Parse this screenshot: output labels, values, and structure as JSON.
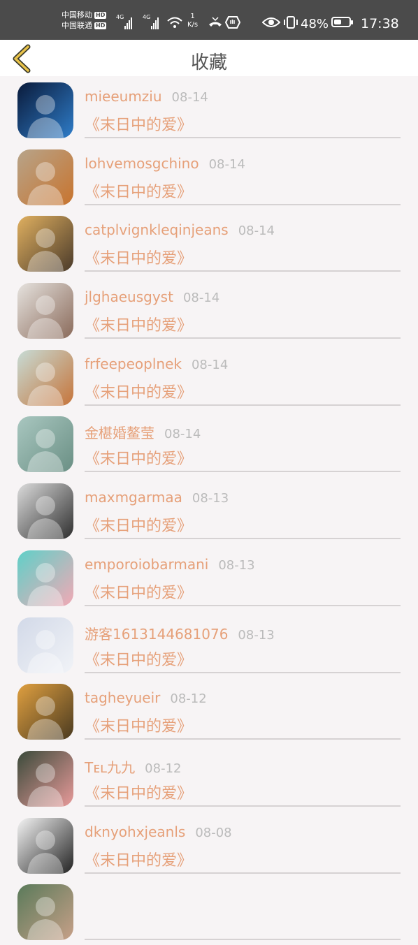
{
  "status_bar": {
    "carrier1": "中国移动",
    "carrier2": "中国联通",
    "hd": "HD",
    "network": "4G",
    "speed_value": "1",
    "speed_unit": "K/s",
    "battery": "48%",
    "battery_level": 0.48,
    "time": "17:38"
  },
  "header": {
    "title": "收藏"
  },
  "favorites": [
    {
      "user": "mieeumziu",
      "date": "08-14",
      "title": "《末日中的爱》",
      "colors": [
        "#0a1a3a",
        "#2f7dc9"
      ]
    },
    {
      "user": "lohvemosgchino",
      "date": "08-14",
      "title": "《末日中的爱》",
      "colors": [
        "#b7a48a",
        "#c8742e"
      ]
    },
    {
      "user": "catplvignkleqinjeans",
      "date": "08-14",
      "title": "《末日中的爱》",
      "colors": [
        "#e0b060",
        "#4a3a2a"
      ]
    },
    {
      "user": "jlghaeusgyst",
      "date": "08-14",
      "title": "《末日中的爱》",
      "colors": [
        "#e6e3df",
        "#8a6a5a"
      ]
    },
    {
      "user": "frfeepeoplnek",
      "date": "08-14",
      "title": "《末日中的爱》",
      "colors": [
        "#c7dcd6",
        "#c6743a"
      ]
    },
    {
      "user": "金椹婚鳌莹",
      "date": "08-14",
      "title": "《末日中的爱》",
      "colors": [
        "#a9c7c0",
        "#6a8f84"
      ]
    },
    {
      "user": "maxmgarmaa",
      "date": "08-13",
      "title": "《末日中的爱》",
      "colors": [
        "#dcdcdc",
        "#2e2e2e"
      ]
    },
    {
      "user": "emporoiobarmani",
      "date": "08-13",
      "title": "《末日中的爱》",
      "colors": [
        "#5fd0c8",
        "#f2a9b5"
      ]
    },
    {
      "user": "游客1613144681076",
      "date": "08-13",
      "title": "《末日中的爱》",
      "colors": [
        "#d2d9e8",
        "#f1f3f7"
      ]
    },
    {
      "user": "tagheyueir",
      "date": "08-12",
      "title": "《末日中的爱》",
      "colors": [
        "#e0a040",
        "#4a3a20"
      ]
    },
    {
      "user": "Tᴇʟ九九",
      "date": "08-12",
      "title": "《末日中的爱》",
      "colors": [
        "#3a4a3a",
        "#e89a9a"
      ]
    },
    {
      "user": "dknyohxjeanls",
      "date": "08-08",
      "title": "《末日中的爱》",
      "colors": [
        "#f5f5f5",
        "#222222"
      ]
    },
    {
      "user": "",
      "date": "",
      "title": "",
      "colors": [
        "#5a7a5a",
        "#c7a088"
      ]
    }
  ]
}
